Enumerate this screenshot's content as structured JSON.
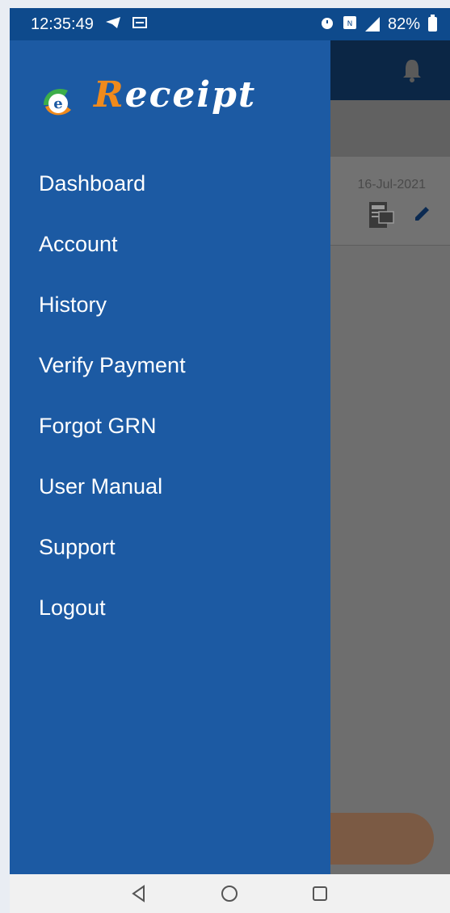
{
  "status_bar": {
    "time": "12:35:49",
    "battery": "82%"
  },
  "app": {
    "card_date": "16-Jul-2021"
  },
  "drawer": {
    "logo_text_first": "R",
    "logo_text_rest": "eceipt",
    "menu": [
      {
        "label": "Dashboard"
      },
      {
        "label": "Account"
      },
      {
        "label": "History"
      },
      {
        "label": "Verify Payment"
      },
      {
        "label": "Forgot GRN"
      },
      {
        "label": "User Manual"
      },
      {
        "label": "Support"
      },
      {
        "label": "Logout"
      }
    ]
  },
  "icons": {
    "status_left": [
      "telegram-icon",
      "message-icon"
    ],
    "status_right": [
      "alarm-icon",
      "nfc-icon",
      "signal-icon",
      "battery-icon"
    ],
    "header": "bell-icon",
    "card": [
      "receipt-icon",
      "edit-icon"
    ],
    "nav": [
      "back-icon",
      "home-icon",
      "recents-icon"
    ]
  },
  "colors": {
    "drawer": "#1c5aa3",
    "status_bar": "#0e4a8c",
    "logo_accent": "#f08a1c"
  }
}
